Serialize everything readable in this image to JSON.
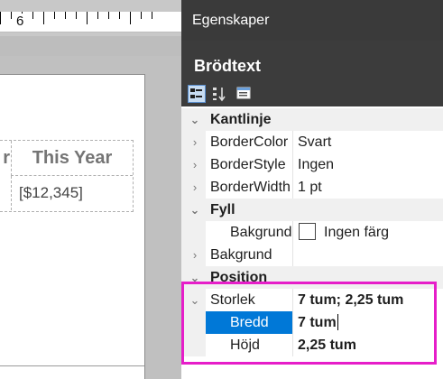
{
  "ruler": {
    "number": "6"
  },
  "report": {
    "header_partial": "r",
    "header": "This Year",
    "data": "[$12,345]"
  },
  "panel": {
    "title": "Egenskaper",
    "object": "Brödtext",
    "toolbar": {
      "categorized_icon": "categorized-icon",
      "alphabetical_icon": "alphabetical-sort-icon",
      "pages_icon": "property-pages-icon"
    }
  },
  "properties": {
    "kantlinje": {
      "label": "Kantlinje"
    },
    "border_color": {
      "name": "BorderColor",
      "value": "Svart"
    },
    "border_style": {
      "name": "BorderStyle",
      "value": "Ingen"
    },
    "border_width": {
      "name": "BorderWidth",
      "value": "1 pt"
    },
    "fyll": {
      "label": "Fyll"
    },
    "bakgrund1": {
      "name": "Bakgrund",
      "value": "Ingen färg"
    },
    "bakgrund2": {
      "name": "Bakgrund",
      "value": ""
    },
    "position": {
      "label": "Position"
    },
    "storlek": {
      "name": "Storlek",
      "value": "7 tum; 2,25 tum"
    },
    "bredd": {
      "name": "Bredd",
      "value": "7 tum"
    },
    "hojd": {
      "name": "Höjd",
      "value": "2,25 tum"
    }
  },
  "colors": {
    "panel_bg": "#3c3c3c",
    "selection": "#0078d7",
    "highlight": "#e61ec9"
  }
}
